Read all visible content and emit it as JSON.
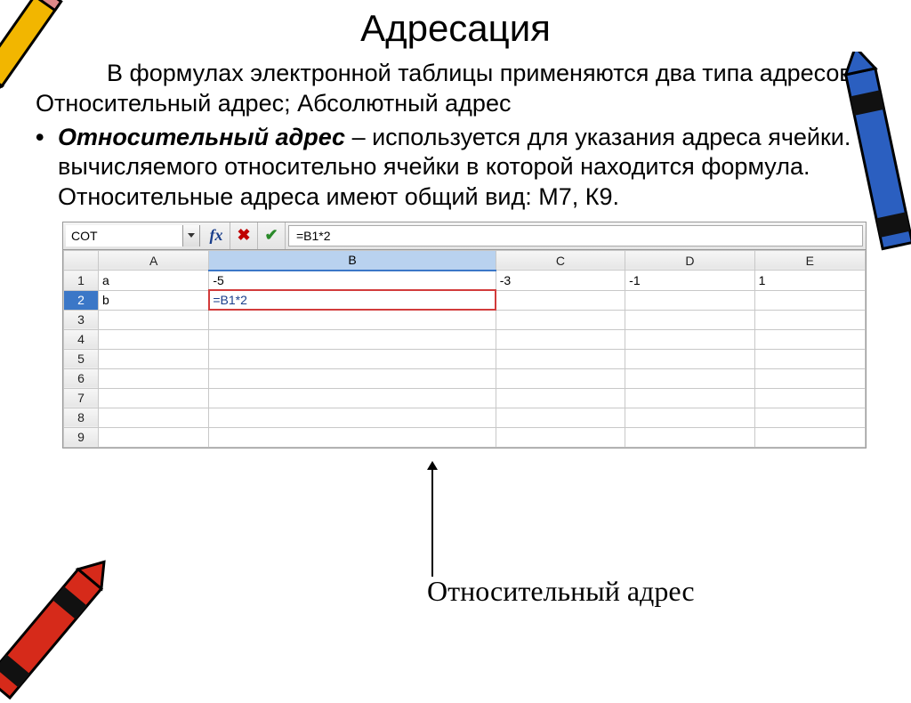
{
  "title": "Адресация",
  "paragraph": "В формулах электронной таблицы применяются два типа адресов:  Относительный адрес; Абсолютный адрес",
  "bullet": {
    "lead": "Относительный адрес",
    "rest": " – используется для указания адреса ячейки. вычисляемого относительно ячейки в которой находится формула. Относительные адреса имеют общий вид: М7, К9."
  },
  "sheet": {
    "namebox": "COT",
    "fx": "fx",
    "cancel": "✖",
    "ok": "✔",
    "formula": "=B1*2",
    "cols": [
      "A",
      "B",
      "C",
      "D",
      "E"
    ],
    "active_col": "B",
    "active_row": "2",
    "rows": [
      {
        "n": "1",
        "cells": [
          "a",
          "-5",
          "-3",
          "-1",
          "1"
        ],
        "align": [
          "l",
          "r",
          "r",
          "r",
          "r"
        ]
      },
      {
        "n": "2",
        "cells": [
          "b",
          "=B1*2",
          "",
          "",
          ""
        ],
        "align": [
          "l",
          "l",
          "l",
          "l",
          "l"
        ],
        "editing_col": 1
      },
      {
        "n": "3",
        "cells": [
          "",
          "",
          "",
          "",
          ""
        ]
      },
      {
        "n": "4",
        "cells": [
          "",
          "",
          "",
          "",
          ""
        ]
      },
      {
        "n": "5",
        "cells": [
          "",
          "",
          "",
          "",
          ""
        ]
      },
      {
        "n": "6",
        "cells": [
          "",
          "",
          "",
          "",
          ""
        ]
      },
      {
        "n": "7",
        "cells": [
          "",
          "",
          "",
          "",
          ""
        ]
      },
      {
        "n": "8",
        "cells": [
          "",
          "",
          "",
          "",
          ""
        ]
      },
      {
        "n": "9",
        "cells": [
          "",
          "",
          "",
          "",
          ""
        ]
      }
    ]
  },
  "callout": "Относительный адрес"
}
